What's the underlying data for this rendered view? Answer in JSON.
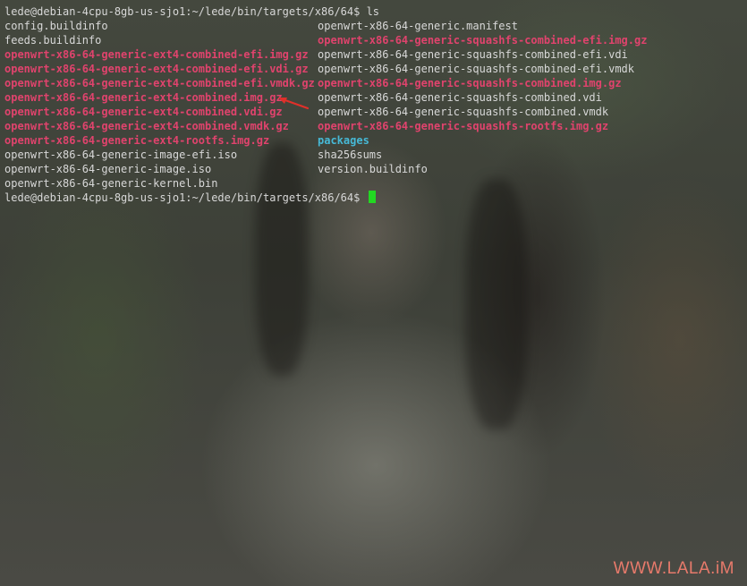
{
  "terminal": {
    "prompt_line": "lede@debian-4cpu-8gb-us-sjo1:~/lede/bin/targets/x86/64$ ls",
    "final_prompt": "lede@debian-4cpu-8gb-us-sjo1:~/lede/bin/targets/x86/64$ ",
    "files_col1": [
      "config.buildinfo",
      "feeds.buildinfo",
      "openwrt-x86-64-generic-ext4-combined-efi.img.gz",
      "openwrt-x86-64-generic-ext4-combined-efi.vdi.gz",
      "openwrt-x86-64-generic-ext4-combined-efi.vmdk.gz",
      "openwrt-x86-64-generic-ext4-combined.img.gz",
      "openwrt-x86-64-generic-ext4-combined.vdi.gz",
      "openwrt-x86-64-generic-ext4-combined.vmdk.gz",
      "openwrt-x86-64-generic-ext4-rootfs.img.gz",
      "openwrt-x86-64-generic-image-efi.iso",
      "openwrt-x86-64-generic-image.iso",
      "openwrt-x86-64-generic-kernel.bin"
    ],
    "files_col2": [
      "openwrt-x86-64-generic.manifest",
      "openwrt-x86-64-generic-squashfs-combined-efi.img.gz",
      "openwrt-x86-64-generic-squashfs-combined-efi.vdi",
      "openwrt-x86-64-generic-squashfs-combined-efi.vmdk",
      "openwrt-x86-64-generic-squashfs-combined.img.gz",
      "openwrt-x86-64-generic-squashfs-combined.vdi",
      "openwrt-x86-64-generic-squashfs-combined.vmdk",
      "openwrt-x86-64-generic-squashfs-rootfs.img.gz",
      "packages",
      "sha256sums",
      "version.buildinfo"
    ]
  },
  "colors": {
    "plain_file": "#d8d8d8",
    "archive_file": "#e0436d",
    "directory": "#46b9d6",
    "cursor": "#22d822",
    "annotation_arrow": "#e0302a",
    "watermark": "#e77a6b"
  },
  "annotation": {
    "icon": "red-arrow-icon"
  },
  "watermark": "WWW.LALA.iM"
}
